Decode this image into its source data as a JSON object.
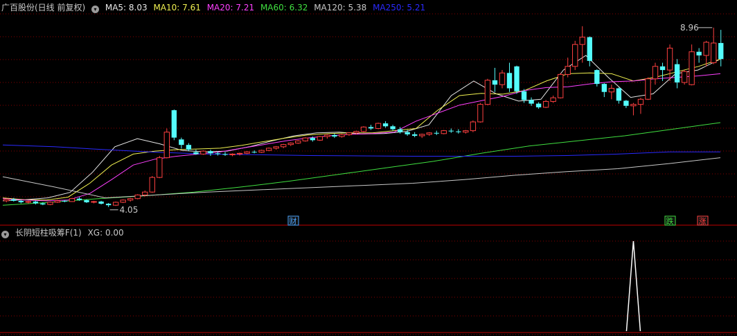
{
  "main_legend": {
    "title": "广百股份(日线 前复权)",
    "ma_items": [
      {
        "label": "MA5: 8.03",
        "color": "#e8e8e8"
      },
      {
        "label": "MA10: 7.61",
        "color": "#f0f050"
      },
      {
        "label": "MA20: 7.21",
        "color": "#ff40ff"
      },
      {
        "label": "MA60: 6.32",
        "color": "#40e040"
      },
      {
        "label": "MA120: 5.38",
        "color": "#c8c8c8"
      },
      {
        "label": "MA250: 5.21",
        "color": "#2a2aff"
      }
    ]
  },
  "price_annotations": {
    "high": "8.96",
    "low": "4.05"
  },
  "event_markers": [
    {
      "label": "财",
      "color": "#4da6ff"
    },
    {
      "label": "跌",
      "color": "#40e040"
    },
    {
      "label": "涨",
      "color": "#ff4040"
    }
  ],
  "sub_legend": {
    "title": "长阴短柱吸筹F(1)",
    "value": "XG: 0.00"
  },
  "colors": {
    "up": "#ff4040",
    "down": "#54fcfc",
    "grid": "#8a0000",
    "axis": "#c00000"
  },
  "chart_data": {
    "type": "candlestick",
    "symbol": "广百股份",
    "y_range": [
      3.8,
      9.3
    ],
    "candles": [
      [
        4.22,
        4.28,
        4.18,
        4.26
      ],
      [
        4.26,
        4.3,
        4.2,
        4.22
      ],
      [
        4.22,
        4.25,
        4.15,
        4.18
      ],
      [
        4.18,
        4.22,
        4.14,
        4.2
      ],
      [
        4.2,
        4.22,
        4.12,
        4.15
      ],
      [
        4.15,
        4.18,
        4.1,
        4.12
      ],
      [
        4.12,
        4.2,
        4.1,
        4.18
      ],
      [
        4.18,
        4.25,
        4.16,
        4.22
      ],
      [
        4.22,
        4.24,
        4.18,
        4.2
      ],
      [
        4.2,
        4.3,
        4.19,
        4.28
      ],
      [
        4.28,
        4.32,
        4.22,
        4.24
      ],
      [
        4.24,
        4.26,
        4.16,
        4.18
      ],
      [
        4.18,
        4.22,
        4.15,
        4.2
      ],
      [
        4.2,
        4.22,
        4.12,
        4.14
      ],
      [
        4.14,
        4.16,
        4.05,
        4.1
      ],
      [
        4.1,
        4.2,
        4.08,
        4.18
      ],
      [
        4.18,
        4.26,
        4.16,
        4.24
      ],
      [
        4.24,
        4.3,
        4.2,
        4.28
      ],
      [
        4.28,
        4.4,
        4.26,
        4.38
      ],
      [
        4.38,
        4.5,
        4.34,
        4.46
      ],
      [
        4.46,
        4.9,
        4.44,
        4.86
      ],
      [
        4.86,
        5.45,
        4.84,
        5.4
      ],
      [
        5.4,
        6.2,
        5.38,
        6.1
      ],
      [
        6.7,
        6.72,
        5.88,
        5.95
      ],
      [
        5.9,
        5.95,
        5.65,
        5.75
      ],
      [
        5.75,
        5.8,
        5.58,
        5.62
      ],
      [
        5.55,
        5.62,
        5.48,
        5.5
      ],
      [
        5.5,
        5.6,
        5.48,
        5.58
      ],
      [
        5.58,
        5.62,
        5.45,
        5.52
      ],
      [
        5.52,
        5.56,
        5.46,
        5.5
      ],
      [
        5.5,
        5.56,
        5.45,
        5.48
      ],
      [
        5.48,
        5.52,
        5.44,
        5.5
      ],
      [
        5.5,
        5.54,
        5.46,
        5.52
      ],
      [
        5.52,
        5.58,
        5.5,
        5.56
      ],
      [
        5.56,
        5.6,
        5.52,
        5.55
      ],
      [
        5.55,
        5.62,
        5.53,
        5.6
      ],
      [
        5.6,
        5.68,
        5.58,
        5.66
      ],
      [
        5.66,
        5.72,
        5.62,
        5.7
      ],
      [
        5.7,
        5.78,
        5.66,
        5.76
      ],
      [
        5.76,
        5.82,
        5.72,
        5.8
      ],
      [
        5.8,
        5.88,
        5.78,
        5.86
      ],
      [
        5.86,
        5.96,
        5.84,
        5.94
      ],
      [
        5.94,
        5.98,
        5.84,
        5.88
      ],
      [
        5.88,
        6.0,
        5.86,
        5.98
      ],
      [
        5.98,
        6.04,
        5.92,
        6.02
      ],
      [
        6.02,
        6.06,
        5.94,
        5.98
      ],
      [
        5.98,
        6.05,
        5.95,
        6.03
      ],
      [
        6.03,
        6.1,
        6.0,
        6.08
      ],
      [
        6.08,
        6.14,
        6.04,
        6.12
      ],
      [
        6.12,
        6.26,
        6.1,
        6.24
      ],
      [
        6.24,
        6.3,
        6.16,
        6.2
      ],
      [
        6.2,
        6.36,
        6.18,
        6.34
      ],
      [
        6.34,
        6.4,
        6.22,
        6.26
      ],
      [
        6.26,
        6.3,
        6.14,
        6.18
      ],
      [
        6.18,
        6.24,
        6.06,
        6.1
      ],
      [
        6.1,
        6.16,
        6.0,
        6.04
      ],
      [
        6.04,
        6.1,
        5.96,
        6.0
      ],
      [
        6.0,
        6.06,
        5.94,
        6.04
      ],
      [
        6.04,
        6.1,
        6.0,
        6.08
      ],
      [
        6.08,
        6.14,
        6.02,
        6.06
      ],
      [
        6.06,
        6.16,
        6.04,
        6.14
      ],
      [
        6.14,
        6.2,
        6.08,
        6.12
      ],
      [
        6.12,
        6.18,
        6.06,
        6.1
      ],
      [
        6.1,
        6.16,
        6.06,
        6.14
      ],
      [
        6.14,
        6.42,
        6.1,
        6.38
      ],
      [
        6.38,
        6.9,
        6.36,
        6.86
      ],
      [
        6.86,
        7.56,
        6.84,
        7.52
      ],
      [
        7.52,
        7.86,
        7.2,
        7.4
      ],
      [
        7.4,
        7.8,
        7.3,
        7.72
      ],
      [
        7.72,
        8.0,
        7.2,
        7.3
      ],
      [
        7.9,
        7.92,
        7.15,
        7.22
      ],
      [
        7.22,
        7.28,
        6.9,
        6.98
      ],
      [
        6.98,
        7.05,
        6.82,
        6.88
      ],
      [
        6.88,
        6.92,
        6.74,
        6.78
      ],
      [
        6.78,
        6.98,
        6.76,
        6.94
      ],
      [
        6.94,
        7.1,
        6.9,
        7.04
      ],
      [
        7.04,
        7.72,
        7.02,
        7.68
      ],
      [
        7.68,
        8.14,
        7.6,
        7.9
      ],
      [
        7.9,
        8.6,
        7.8,
        8.5
      ],
      [
        8.5,
        9.0,
        8.0,
        8.7
      ],
      [
        8.7,
        8.72,
        7.9,
        8.05
      ],
      [
        7.8,
        7.82,
        7.35,
        7.42
      ],
      [
        7.42,
        7.44,
        7.06,
        7.2
      ],
      [
        7.2,
        7.4,
        7.0,
        7.3
      ],
      [
        7.3,
        7.32,
        6.88,
        6.96
      ],
      [
        6.96,
        6.98,
        6.76,
        6.82
      ],
      [
        6.82,
        6.9,
        6.56,
        6.86
      ],
      [
        6.86,
        7.04,
        6.6,
        7.0
      ],
      [
        7.0,
        7.6,
        6.98,
        7.56
      ],
      [
        7.56,
        8.0,
        7.4,
        7.9
      ],
      [
        7.9,
        8.0,
        7.5,
        7.8
      ],
      [
        7.8,
        8.5,
        7.5,
        8.4
      ],
      [
        7.96,
        8.1,
        7.3,
        7.46
      ],
      [
        7.46,
        7.8,
        7.4,
        7.76
      ],
      [
        7.4,
        8.5,
        7.38,
        8.3
      ],
      [
        8.3,
        8.4,
        8.0,
        8.2
      ],
      [
        8.2,
        8.6,
        7.9,
        8.56
      ],
      [
        8.0,
        8.96,
        7.96,
        8.54
      ],
      [
        8.54,
        8.9,
        7.9,
        8.1
      ]
    ],
    "moving_averages": {
      "MA5": [
        [
          4.22,
          4.25,
          4.3,
          4.45,
          5.0,
          5.7,
          5.92,
          5.78,
          5.6,
          5.56,
          5.58,
          5.7,
          5.86,
          6.0,
          6.08,
          6.1,
          6.05,
          6.06,
          6.12,
          6.3,
          7.1,
          7.5,
          7.15,
          6.95,
          7.0,
          7.8,
          8.2,
          7.6,
          7.05,
          7.15,
          7.7,
          7.8,
          8.1
        ]
      ],
      "MA10": [
        [
          4.3,
          4.25,
          4.24,
          4.32,
          4.7,
          5.2,
          5.5,
          5.58,
          5.62,
          5.64,
          5.66,
          5.74,
          5.84,
          5.94,
          6.02,
          6.06,
          6.08,
          6.08,
          6.14,
          6.2,
          6.7,
          7.1,
          7.16,
          7.14,
          7.24,
          7.5,
          7.7,
          7.72,
          7.7,
          7.5,
          7.6,
          7.75,
          7.9,
          8.1
        ]
      ],
      "MA20": [
        [
          4.28,
          4.24,
          4.22,
          4.24,
          4.42,
          4.8,
          5.2,
          5.36,
          5.44,
          5.5,
          5.56,
          5.66,
          5.76,
          5.86,
          5.94,
          6.0,
          6.04,
          6.06,
          6.1,
          6.4,
          6.62,
          6.84,
          6.96,
          7.08,
          7.24,
          7.32,
          7.34,
          7.42,
          7.48,
          7.5,
          7.56,
          7.6,
          7.64,
          7.7
        ]
      ],
      "MA60": [
        [
          4.1,
          4.18,
          4.28,
          4.36,
          4.46,
          4.6,
          4.76,
          4.94,
          5.12,
          5.3,
          5.52,
          5.72,
          5.86,
          6.0,
          6.18,
          6.36
        ]
      ],
      "MA120": [
        [
          4.88,
          4.6,
          4.3,
          4.38,
          4.46,
          4.52,
          4.58,
          4.64,
          4.7,
          4.8,
          4.92,
          5.02,
          5.1,
          5.24,
          5.4
        ]
      ],
      "MA250": [
        [
          5.75,
          5.7,
          5.62,
          5.55,
          5.5,
          5.48,
          5.46,
          5.45,
          5.44,
          5.44,
          5.44,
          5.46,
          5.5,
          5.56,
          5.56
        ]
      ]
    },
    "indicator": {
      "name": "长阴短柱吸筹F(1)",
      "xg_spike_index": 86
    }
  }
}
